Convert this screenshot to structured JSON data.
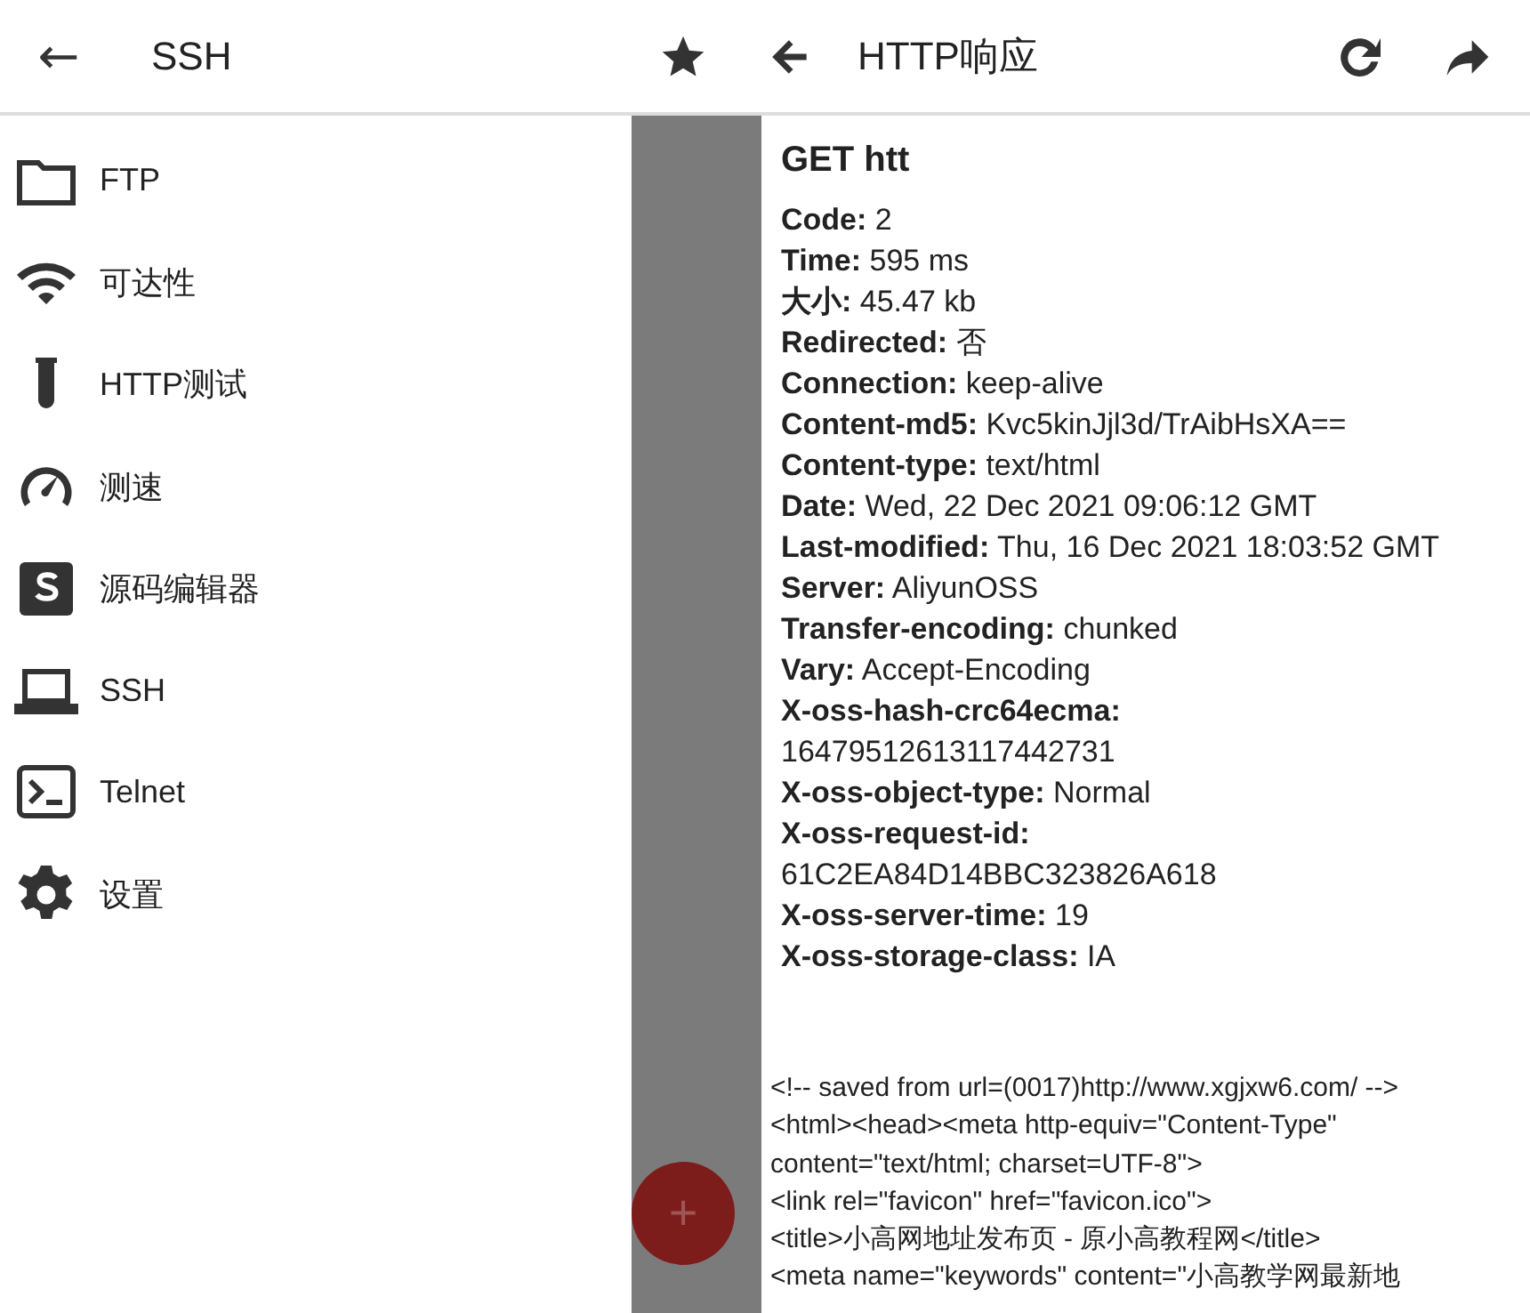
{
  "left_bar": {
    "back": "←",
    "title": "SSH"
  },
  "right_bar": {
    "title": "HTTP响应"
  },
  "menu": [
    {
      "label": "FTP"
    },
    {
      "label": "可达性"
    },
    {
      "label": "HTTP测试"
    },
    {
      "label": "测速"
    },
    {
      "label": "源码编辑器"
    },
    {
      "label": "SSH"
    },
    {
      "label": "Telnet"
    },
    {
      "label": "设置"
    }
  ],
  "fab": "+",
  "request": "GET htt",
  "headers": [
    "**Code:** 2",
    "**Time:** 595 ms",
    "**大小:** 45.47 kb",
    "**Redirected:** 否",
    "**Connection:** keep-alive",
    "**Content-md5:** Kvc5kinJjl3d/TrAibHsXA==",
    "**Content-type:** text/html",
    "**Date:** Wed, 22 Dec 2021 09:06:12 GMT",
    "**Last-modified:** Thu, 16 Dec 2021 18:03:52 GMT",
    "**Server:** AliyunOSS",
    "**Transfer-encoding:** chunked",
    "**Vary:** Accept-Encoding",
    "**X-oss-hash-crc64ecma:**",
    "16479512613117442731",
    "**X-oss-object-type:** Normal",
    "**X-oss-request-id:**",
    "61C2EA84D14BBC323826A618",
    "**X-oss-server-time:** 19",
    "**X-oss-storage-class:** IA"
  ],
  "source": [
    "<!-- saved from url=(0017)http://www.xgjxw6.com/ -->",
    "<html><head><meta http-equiv=\"Content-Type\"",
    "content=\"text/html; charset=UTF-8\">",
    "<link rel=\"favicon\" href=\"favicon.ico\">",
    "<title>小高网地址发布页 - 原小高教程网</title>",
    "<meta name=\"keywords\" content=\"小高教学网最新地"
  ]
}
